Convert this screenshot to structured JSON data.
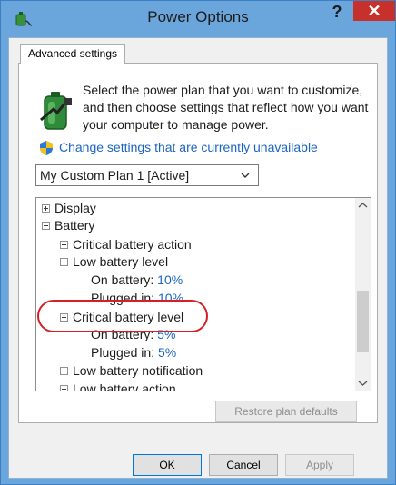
{
  "window": {
    "title": "Power Options",
    "help_label": "?",
    "close_label": "✕"
  },
  "tab": {
    "label": "Advanced settings"
  },
  "intro": {
    "text": "Select the power plan that you want to customize, and then choose settings that reflect how you want your computer to manage power."
  },
  "change_link": {
    "label": "Change settings that are currently unavailable"
  },
  "plan_select": {
    "value": "My Custom Plan 1 [Active]"
  },
  "tree": {
    "display": "Display",
    "battery": "Battery",
    "critical_battery_action": "Critical battery action",
    "low_battery_level": "Low battery level",
    "low_on_battery_label": "On battery:",
    "low_on_battery_value": "10%",
    "low_plugged_in_label": "Plugged in:",
    "low_plugged_in_value": "10%",
    "critical_battery_level": "Critical battery level",
    "crit_on_battery_label": "On battery:",
    "crit_on_battery_value": "5%",
    "crit_plugged_in_label": "Plugged in:",
    "crit_plugged_in_value": "5%",
    "low_battery_notification": "Low battery notification",
    "low_battery_action": "Low battery action"
  },
  "buttons": {
    "restore": "Restore plan defaults",
    "ok": "OK",
    "cancel": "Cancel",
    "apply": "Apply"
  },
  "colors": {
    "titlebar": "#6aa6dc",
    "close": "#c7312c",
    "link": "#1a65c0",
    "highlight_ring": "#d51f26"
  }
}
